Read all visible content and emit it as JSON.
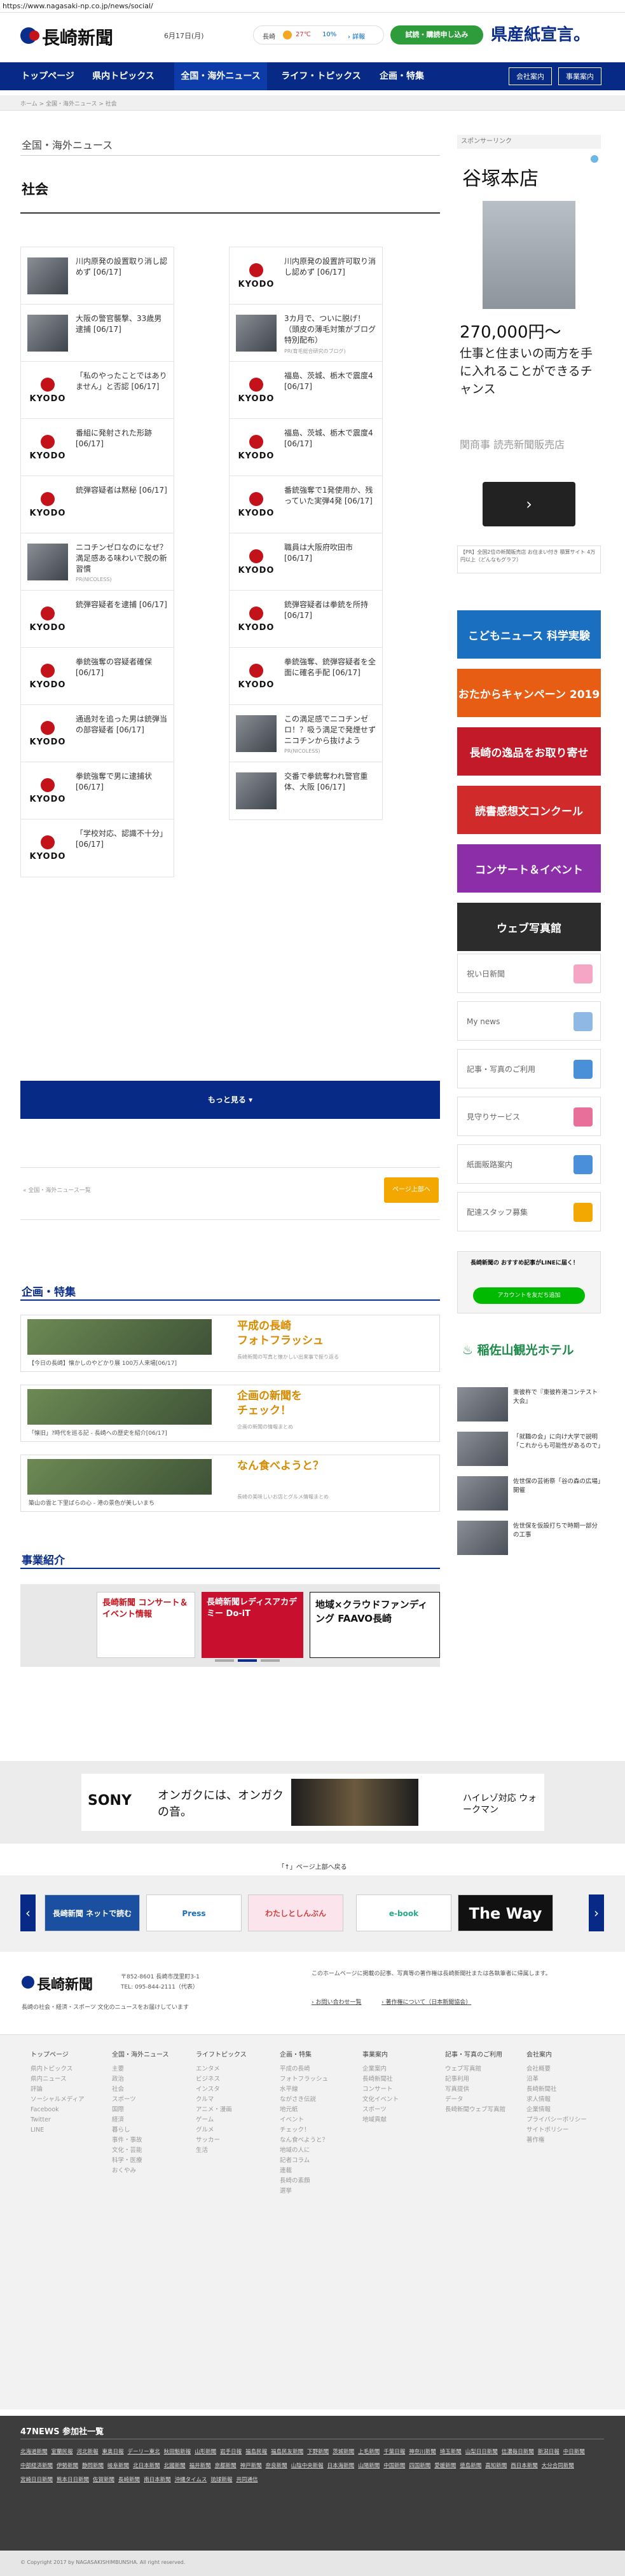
{
  "browser": {
    "url": "https://www.nagasaki-np.co.jp/news/social/"
  },
  "header": {
    "logo": "長崎新聞",
    "date": "6月17日(月)",
    "weather_city": "長崎",
    "weather_temp": "27℃",
    "weather_rain": "10%",
    "weather_link": "› 詳報",
    "trial_button": "試読・購読申し込み",
    "ad_text": "県産紙宣言。"
  },
  "gnav": {
    "items": [
      "トップページ",
      "県内トピックス",
      "全国・海外ニュース",
      "ライフ・トピックス",
      "企画・特集"
    ],
    "sub_buttons": [
      "会社案内",
      "事業案内"
    ]
  },
  "breadcrumb": "ホーム > 全国・海外ニュース > 社会",
  "page": {
    "category": "全国・海外ニュース",
    "section": "社会",
    "more_button": "もっと見る ▾",
    "back_link": "« 全国・海外ニュース一覧",
    "page_top": "ページ上部へ"
  },
  "articles": [
    {
      "text": "川内原発の設置取り消し認めず [06/17]",
      "thumb": "photo"
    },
    {
      "text": "川内原発の設置許可取り消し認めず [06/17]",
      "thumb": "kyodo"
    },
    {
      "text": "大阪の警官襲撃、33歳男逮捕 [06/17]",
      "thumb": "photo"
    },
    {
      "text": "3カ月で、ついに脱げ！（頭皮の薄毛対策がブログ特別配布）",
      "thumb": "photo",
      "source": "PR(育毛総合研究のブログ)"
    },
    {
      "text": "「私のやったことではありません」と否認 [06/17]",
      "thumb": "kyodo"
    },
    {
      "text": "福島、茨城、栃木で震度4 [06/17]",
      "thumb": "kyodo"
    },
    {
      "text": "番組に発射された形跡 [06/17]",
      "thumb": "kyodo"
    },
    {
      "text": "福島、茨城、栃木で震度4 [06/17]",
      "thumb": "kyodo"
    },
    {
      "text": "銃弾容疑者は黙秘 [06/17]",
      "thumb": "kyodo"
    },
    {
      "text": "番銃強奪で1発使用か、残っていた実弾4発 [06/17]",
      "thumb": "kyodo"
    },
    {
      "text": "ニコチンゼロなのになぜ？満足感ある味わいで脱の新習慣",
      "thumb": "photo",
      "source": "PR(NICOLESS)"
    },
    {
      "text": "職員は大阪府吹田市 [06/17]",
      "thumb": "kyodo"
    },
    {
      "text": "銃弾容疑者を逮捕 [06/17]",
      "thumb": "kyodo"
    },
    {
      "text": "銃弾容疑者は拳銃を所持 [06/17]",
      "thumb": "kyodo"
    },
    {
      "text": "拳銃強奪の容疑者確保 [06/17]",
      "thumb": "kyodo"
    },
    {
      "text": "拳銃強奪、銃弾容疑者を全面に確名手配 [06/17]",
      "thumb": "kyodo"
    },
    {
      "text": "通過対を追った男は銃弾当の部容疑者 [06/17]",
      "thumb": "kyodo"
    },
    {
      "text": "この満足感でニコチンゼロ！？吸う満足で発煙せずニコチンから抜けよう",
      "thumb": "photo",
      "source": "PR(NICOLESS)"
    },
    {
      "text": "拳銃強奪で男に逮捕状 [06/17]",
      "thumb": "kyodo"
    },
    {
      "text": "交番で拳銃奪われ警官重体、大阪 [06/17]",
      "thumb": "photo"
    },
    {
      "text": "「学校対応、認識不十分」 [06/17]",
      "thumb": "kyodo"
    }
  ],
  "sidebar": {
    "sponsored_label": "スポンサーリンク",
    "ad_title": "谷塚本店",
    "ad_price": "270,000円〜",
    "ad_copy": "仕事と住まいの両方を手に入れることができるチャンス",
    "ad_source": "関商事 読売新聞販売店",
    "ad_caption": "【PR】全国2位の新聞販売店 お住まい付き 積算サイト 4万円以上（どんなもグラフ）",
    "banners": [
      "こどもニュース 科学実験",
      "おたからキャンペーン 2019",
      "長崎の逸品をお取り寄せ",
      "読書感想文コンクール",
      "コンサート＆イベント",
      "ウェブ写真館"
    ],
    "boxes": [
      "祝い日新聞",
      "My news",
      "記事・写真のご利用",
      "見守りサービス",
      "紙面販路案内",
      "配達スタッフ募集"
    ],
    "line_title": "長崎新聞の おすすめ記事がLINEに届く！",
    "line_button": "アカウントを友だち追加",
    "hotel": "稲佐山観光ホテル",
    "news": [
      "東彼杵で『東彼杵港コンテスト大会』",
      "「就職の会」に向け大学で説明「これからも可能性があるので」",
      "佐世保の芸術祭「谷の森の広場」開催",
      "佐世保を仮設打ちで時期一部分の工事"
    ]
  },
  "plans": {
    "title": "企画・特集",
    "items": [
      {
        "caption": "【今日の長崎】懐かしのやどかり展 100万人来場[06/17]",
        "title": "平成の長崎\nフォトフラッシュ",
        "desc": "長崎新聞の写真と懐かしい出来事で振り返る"
      },
      {
        "caption": "「懐旧」?時代を巡る記 - 長崎への歴史を紹介[06/17]",
        "title": "企画の新聞を\nチェック！",
        "desc": "企画の新聞の情報まとめ"
      },
      {
        "caption": "築山の雲と下里ばらの心 - 港の景色が美しいまち",
        "title": "なん食べようと？",
        "desc": "長崎の美味しいお店とグルメ情報まとめ"
      }
    ]
  },
  "business": {
    "title": "事業紹介",
    "items": [
      "長崎新聞 コンサート＆イベント情報",
      "長崎新聞レディスアカデミー Do-iT",
      "地域×クラウドファンディング FAAVO長崎"
    ]
  },
  "sony_ad": {
    "brand": "SONY",
    "copy": "オンガクには、オンガクの音。",
    "product": "ハイレゾ対応 ウォークマン"
  },
  "bottom_banner": {
    "top_link": "「↑」ページ上部へ戻る",
    "items": [
      "長崎新聞 ネットで読む",
      "Press",
      "わたしとしんぶん",
      "e-book",
      "The Way"
    ]
  },
  "footer": {
    "logo": "長崎新聞",
    "address": "〒852-8601 長崎市茂里町3-1",
    "tel": "TEL: 095-844-2111（代表）",
    "tagline": "長崎の社会・経済・スポーツ 文化のニュースをお届けしています",
    "notice": "このホームページに掲載の記事、写真等の著作権は長崎新聞社または各執筆者に帰属します。",
    "links": [
      "› お問い合わせ一覧",
      "› 著作権について（日本新聞協会）"
    ],
    "columns": [
      {
        "head": "トップページ",
        "items": [
          "県内トピックス",
          "県内ニュース",
          "評論",
          "ソーシャルメディア",
          "Facebook",
          "Twitter",
          "LINE"
        ]
      },
      {
        "head": "全国・海外ニュース",
        "items": [
          "主要",
          "政治",
          "社会",
          "スポーツ",
          "国際",
          "経済",
          "暮らし",
          "事件・事故",
          "文化・芸能",
          "科学・医療",
          "おくやみ"
        ]
      },
      {
        "head": "ライフトピックス",
        "items": [
          "エンタメ",
          "ビジネス",
          "インスタ",
          "クルマ",
          "アニメ・漫画",
          "ゲーム",
          "グルメ",
          "サッカー",
          "生活"
        ]
      },
      {
        "head": "企画・特集",
        "items": [
          "平成の長崎",
          "フォトフラッシュ",
          "水平線",
          "ながさき伝説",
          "地元紙",
          "イベント",
          "チェック！",
          "なん食べようと？",
          "地域の人に",
          "記者コラム",
          "連載",
          "長崎の素顔",
          "選挙"
        ]
      },
      {
        "head": "事業案内",
        "items": [
          "企業案内",
          "長崎新聞社",
          "コンサート",
          "文化イベント",
          "スポーツ",
          "地域貢献"
        ]
      },
      {
        "head": "記事・写真のご利用",
        "items": [
          "ウェブ写真館",
          "記事利用",
          "写真提供",
          "データ",
          "長崎新聞ウェブ写真館"
        ]
      },
      {
        "head": "会社案内",
        "items": [
          "会社概要",
          "沿革",
          "長崎新聞社",
          "求人情報",
          "企業情報",
          "プライバシーポリシー",
          "サイトポリシー",
          "著作権"
        ]
      }
    ]
  },
  "press47": {
    "title": "47NEWS 参加社一覧",
    "papers": [
      "北海道新聞",
      "室蘭民報",
      "河北新報",
      "東奥日報",
      "デーリー東北",
      "秋田魁新報",
      "山形新聞",
      "岩手日報",
      "福島民報",
      "福島民友新聞",
      "下野新聞",
      "茨城新聞",
      "上毛新聞",
      "千葉日報",
      "神奈川新聞",
      "埼玉新聞",
      "山梨日日新聞",
      "信濃毎日新聞",
      "新潟日報",
      "中日新聞",
      "中部経済新聞",
      "伊勢新聞",
      "静岡新聞",
      "岐阜新聞",
      "北日本新聞",
      "北國新聞",
      "福井新聞",
      "京都新聞",
      "神戸新聞",
      "奈良新聞",
      "山陰中央新報",
      "日本海新聞",
      "山陽新聞",
      "中国新聞",
      "四国新聞",
      "愛媛新聞",
      "徳島新聞",
      "高知新聞",
      "西日本新聞",
      "大分合同新聞",
      "宮崎日日新聞",
      "熊本日日新聞",
      "佐賀新聞",
      "長崎新聞",
      "南日本新聞",
      "沖縄タイムス",
      "琉球新報",
      "共同通信"
    ]
  },
  "copyright": "© Copyright 2017 by NAGASAKISHIMBUNSHA. All right reserved.",
  "colors": {
    "navy": "#062a86",
    "green": "#2e9c3a",
    "orange": "#f2a800"
  }
}
